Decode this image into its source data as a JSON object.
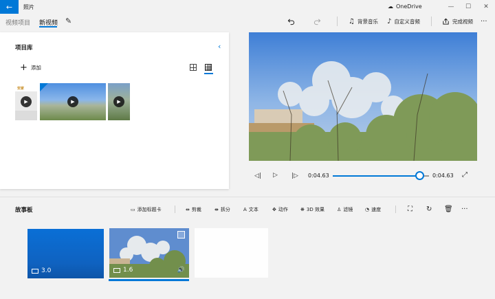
{
  "titlebar": {
    "app_title": "照片",
    "onedrive": "OneDrive"
  },
  "header": {
    "breadcrumb_root": "视频项目",
    "breadcrumb_current": "新视频",
    "music_label": "背景音乐",
    "custom_audio_label": "自定义音频",
    "finish_label": "完成视频",
    "more_label": "···"
  },
  "library": {
    "title": "项目库",
    "add_label": "添加",
    "thumbs": [
      {
        "caption": "安家"
      }
    ]
  },
  "player": {
    "current_time": "0:04.63",
    "end_time": "0:04.63",
    "progress": 0.91
  },
  "storyboard": {
    "title": "故事板",
    "tools": {
      "add_title_card": "添加标题卡",
      "trim": "剪裁",
      "split": "拆分",
      "text": "文本",
      "motion": "动作",
      "effects_3d": "3D 效果",
      "filters": "滤镜",
      "speed": "速度",
      "more": "···"
    },
    "clips": [
      {
        "duration": "3.0"
      },
      {
        "duration": "1.6"
      }
    ]
  },
  "colors": {
    "accent": "#0078d7",
    "title_card": "#0a6fd6"
  }
}
